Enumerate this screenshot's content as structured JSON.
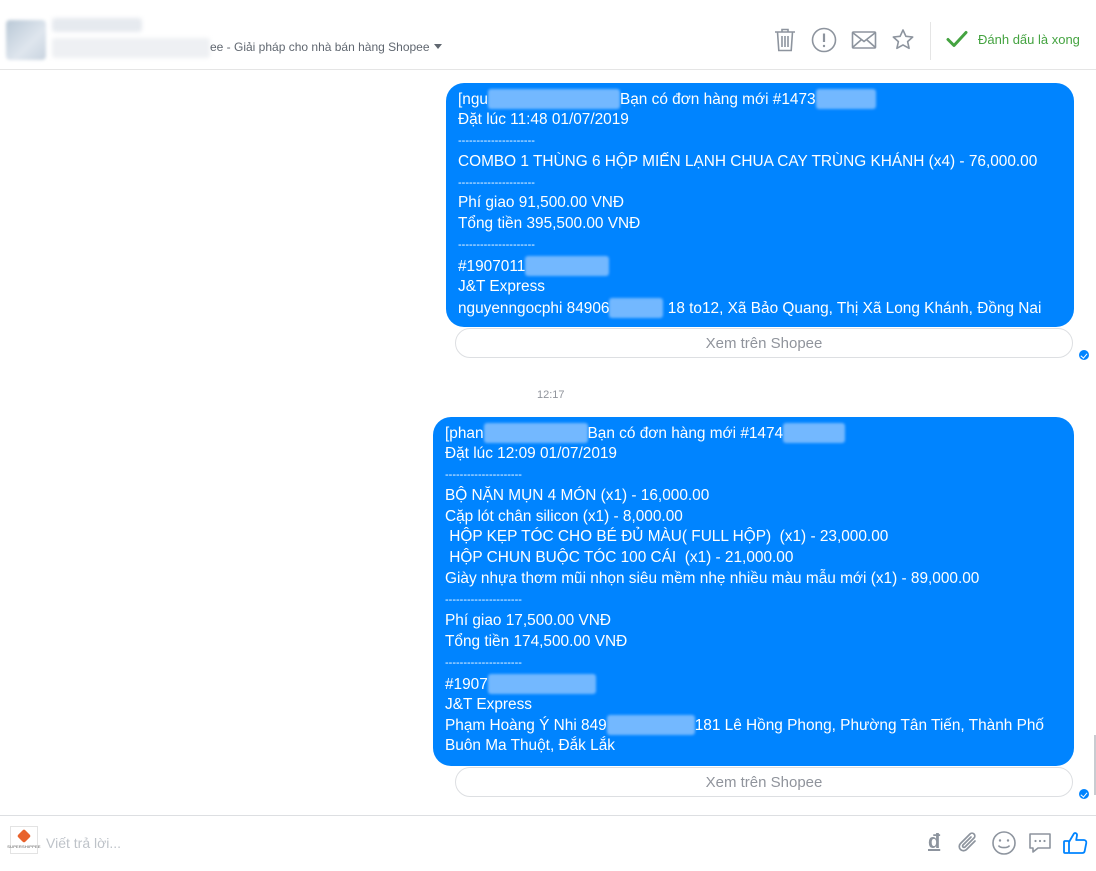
{
  "header": {
    "subtitle": "ee - Giải pháp cho nhà bán hàng Shopee",
    "mark_done_label": "Đánh dấu là xong",
    "icons": [
      "trash-icon",
      "alert-icon",
      "envelope-icon",
      "star-icon",
      "checkmark-icon"
    ]
  },
  "messages": [
    {
      "lines": [
        {
          "pre": "[ngu",
          "post": "Bạn có đơn hàng mới #1473"
        },
        {
          "text": "Đặt lúc 11:48 01/07/2019"
        },
        {
          "text": "---------------------"
        },
        {
          "text": "COMBO 1 THÙNG 6 HỘP MIẾN LẠNH CHUA CAY TRÙNG KHÁNH (x4) - 76,000.00"
        },
        {
          "text": "---------------------"
        },
        {
          "text": "Phí giao 91,500.00 VNĐ"
        },
        {
          "text": "Tổng tiền 395,500.00 VNĐ"
        },
        {
          "text": "---------------------"
        },
        {
          "pre": "#1907011",
          "post": ""
        },
        {
          "text": "J&T Express"
        },
        {
          "pre": "nguyenngocphi 84906",
          "post": " 18 to12, Xã Bảo Quang, Thị Xã Long Khánh, Đồng Nai"
        }
      ],
      "view_button": "Xem trên Shopee"
    },
    {
      "lines": [
        {
          "pre": "[phan",
          "post": "Bạn có đơn hàng mới #1474"
        },
        {
          "text": "Đặt lúc 12:09 01/07/2019"
        },
        {
          "text": "---------------------"
        },
        {
          "text": "BỘ NẶN MỤN 4 MÓN (x1) - 16,000.00"
        },
        {
          "text": "Cặp lót chân silicon (x1) - 8,000.00"
        },
        {
          "text": " HỘP KẸP TÓC CHO BÉ ĐỦ MÀU( FULL HỘP)  (x1) - 23,000.00"
        },
        {
          "text": " HỘP CHUN BUỘC TÓC 100 CÁI  (x1) - 21,000.00"
        },
        {
          "text": "Giày nhựa thơm mũi nhọn siêu mềm nhẹ nhiều màu mẫu mới (x1) - 89,000.00"
        },
        {
          "text": "---------------------"
        },
        {
          "text": "Phí giao 17,500.00 VNĐ"
        },
        {
          "text": "Tổng tiền 174,500.00 VNĐ"
        },
        {
          "text": "---------------------"
        },
        {
          "pre": "#1907",
          "post": ""
        },
        {
          "text": "J&T Express"
        },
        {
          "pre": "Phạm Hoàng Ý Nhi 849",
          "post": "181 Lê Hồng Phong, Phường Tân Tiến, Thành Phố"
        },
        {
          "text": "Buôn Ma Thuột, Đắk Lắk"
        }
      ],
      "view_button": "Xem trên Shopee"
    }
  ],
  "timestamp": "12:17",
  "composer": {
    "placeholder": "Viết trả lời...",
    "avatar_text": "SUPERSHIPPEE",
    "currency_symbol": "đ",
    "icons": [
      "currency-icon",
      "attach-icon",
      "emoji-icon",
      "chat-icon",
      "like-icon"
    ]
  },
  "colors": {
    "bubble": "#0084ff",
    "accent": "#4267b2",
    "done_green": "#44a340"
  }
}
